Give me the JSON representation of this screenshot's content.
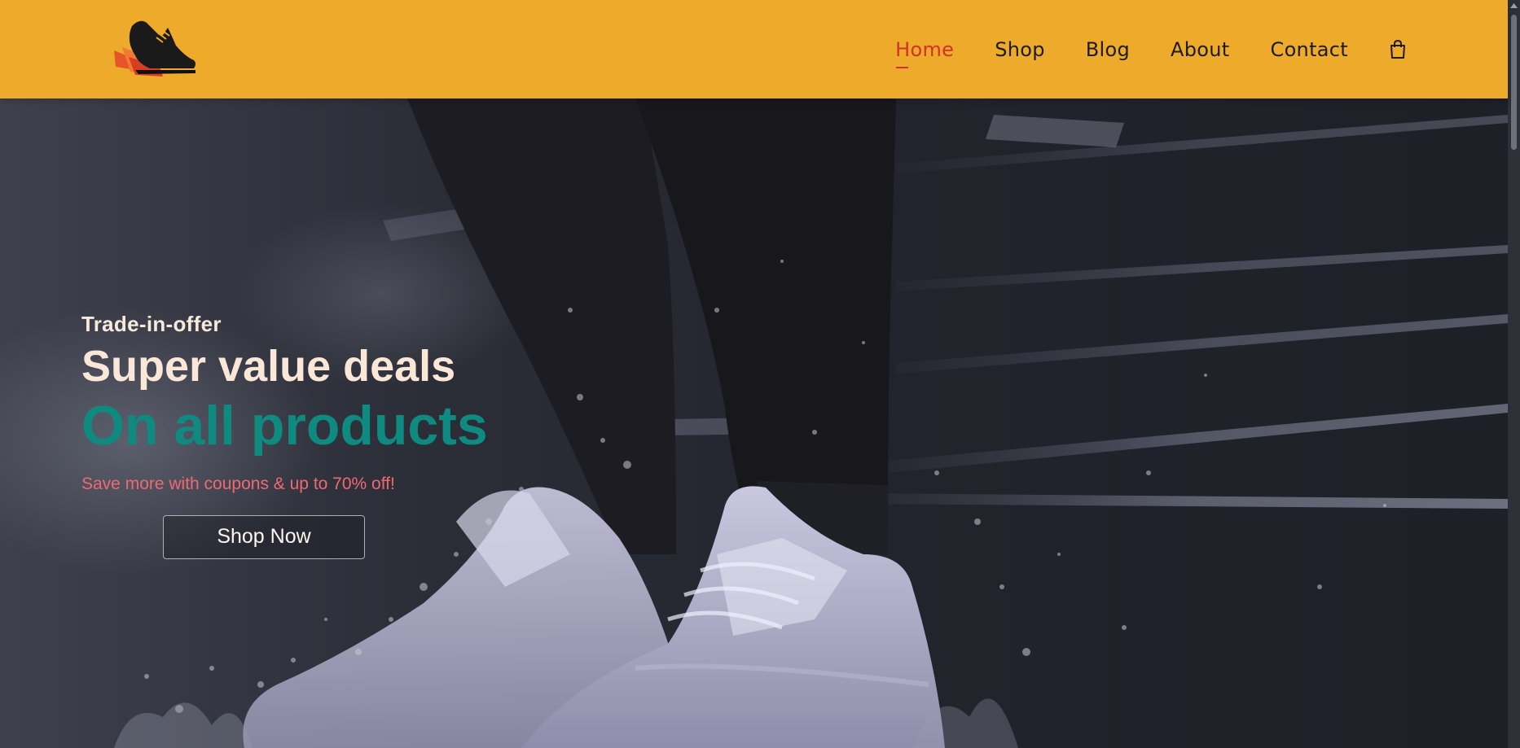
{
  "brand": {
    "logo_icon": "running-shoe-logo-icon"
  },
  "nav": {
    "items": [
      {
        "label": "Home",
        "active": true
      },
      {
        "label": "Shop",
        "active": false
      },
      {
        "label": "Blog",
        "active": false
      },
      {
        "label": "About",
        "active": false
      },
      {
        "label": "Contact",
        "active": false
      }
    ],
    "cart_icon": "shopping-bag-icon"
  },
  "hero": {
    "eyebrow": "Trade-in-offer",
    "headline": "Super value deals",
    "subheadline": "On all products",
    "tagline": "Save more with coupons & up to 70% off!",
    "cta_label": "Shop Now"
  },
  "colors": {
    "header_bg": "#eeaa2a",
    "nav_active": "#d3312b",
    "nav_text": "#1c1c1c",
    "headline": "#fbe7d8",
    "subheadline": "#0f8a80",
    "tagline": "#ef6a70",
    "hero_bg": "#22242e"
  }
}
